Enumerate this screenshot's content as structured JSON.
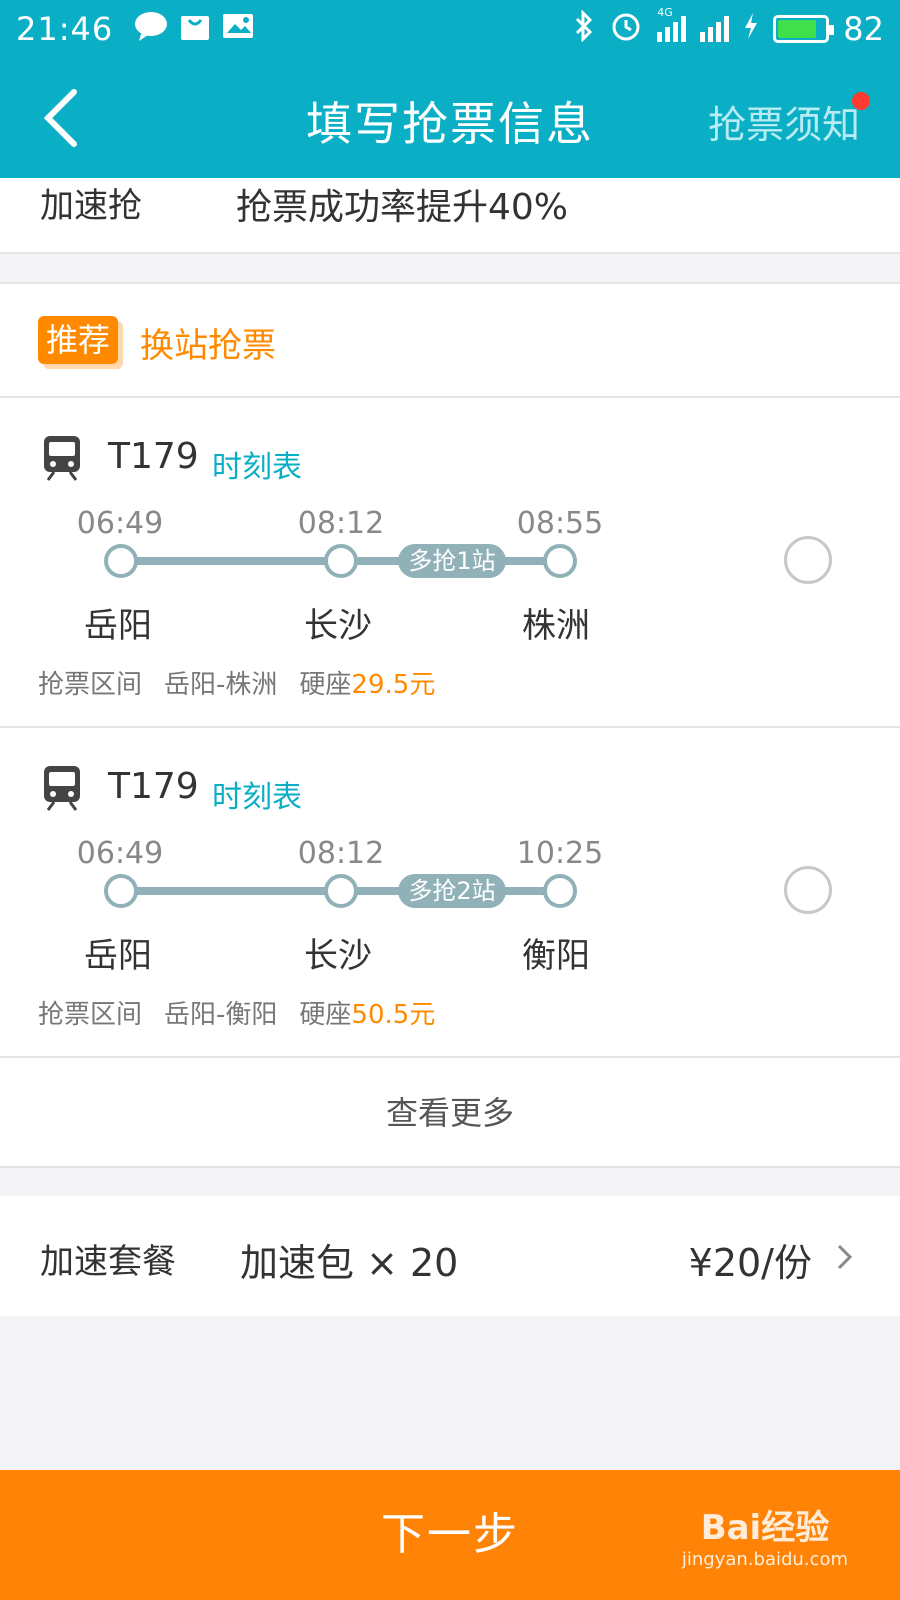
{
  "status_bar": {
    "time": "21:46",
    "battery_level": "82",
    "network": "4G"
  },
  "nav": {
    "title": "填写抢票信息",
    "notice_link": "抢票须知"
  },
  "acceleration": {
    "label": "加速抢",
    "value": "抢票成功率提升40%"
  },
  "recommend": {
    "badge": "推荐",
    "title": "换站抢票"
  },
  "trains": [
    {
      "number": "T179",
      "timetable_link": "时刻表",
      "times": [
        "06:49",
        "08:12",
        "08:55"
      ],
      "stations": [
        "岳阳",
        "长沙",
        "株洲"
      ],
      "extra_stops": "多抢1站",
      "range_label": "抢票区间",
      "range_value": "岳阳-株洲",
      "seat_type": "硬座",
      "price": "29.5元"
    },
    {
      "number": "T179",
      "timetable_link": "时刻表",
      "times": [
        "06:49",
        "08:12",
        "10:25"
      ],
      "stations": [
        "岳阳",
        "长沙",
        "衡阳"
      ],
      "extra_stops": "多抢2站",
      "range_label": "抢票区间",
      "range_value": "岳阳-衡阳",
      "seat_type": "硬座",
      "price": "50.5元"
    }
  ],
  "more_button": "查看更多",
  "package": {
    "label": "加速套餐",
    "value": "加速包 × 20",
    "price": "¥20/份"
  },
  "next_button": "下一步",
  "watermark": {
    "logo": "Bai经验",
    "url": "jingyan.baidu.com"
  },
  "colors": {
    "header": "#0aafc6",
    "accent_orange": "#ff8a00",
    "route_line": "#90b1b7"
  }
}
